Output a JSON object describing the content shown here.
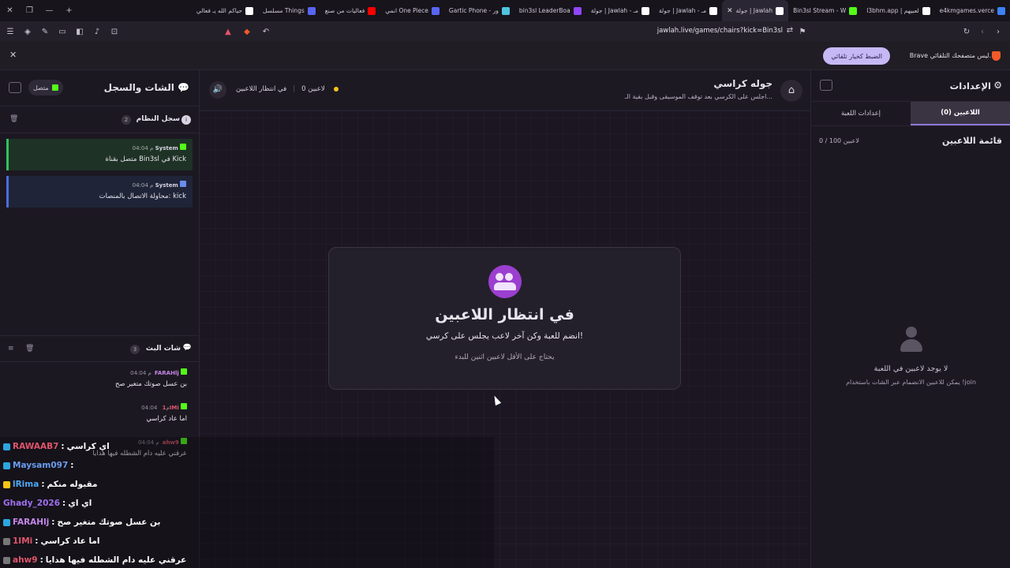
{
  "browser": {
    "tabs": [
      {
        "label": "e4kmgames.verce",
        "color": "#3b82f6"
      },
      {
        "label": "l3bhm.app | لعبيهم",
        "color": "#ffffff"
      },
      {
        "label": "Bin3sl Stream - W",
        "color": "#53fc18"
      },
      {
        "label": "جولة | Jawlah",
        "color": "#ffffff",
        "active": true
      },
      {
        "label": "جولة | Jawlah - مـ",
        "color": "#ffffff"
      },
      {
        "label": "جولة | Jawlah - مـ",
        "color": "#ffffff"
      },
      {
        "label": "bin3sl LeaderBoa",
        "color": "#9146ff"
      },
      {
        "label": "Gartic Phone - ور",
        "color": "#4ec3e0"
      },
      {
        "label": "انمي One Piece",
        "color": "#5865f2"
      },
      {
        "label": "فعاليات من صنع",
        "color": "#ff0000"
      },
      {
        "label": "مسلسل Things",
        "color": "#5865f2"
      },
      {
        "label": "حياكم الله يـ فعالي",
        "color": "#ffffff"
      }
    ],
    "url": "jawlah.live/games/chairs?kick=Bin3sl",
    "brave_message": "Brave ليس متصفحك التلقائي.",
    "brave_button": "الضبط كخيار تلقائي"
  },
  "left_panel": {
    "title": "الشات والسجل",
    "connection": "متصل",
    "system_log": {
      "title": "سجل النظام",
      "count": "2",
      "messages": [
        {
          "user": "System",
          "time": "04:04 م",
          "text": "متصل بقناة Bin3sl في Kick",
          "style": "g"
        },
        {
          "user": "System",
          "time": "04:04 م",
          "text": "محاولة الاتصال بالمنصات: kick",
          "style": "b"
        }
      ]
    },
    "stream_chat": {
      "title": "شات البث",
      "count": "3",
      "messages": [
        {
          "user": "FARAHlj",
          "time": "04:04 م",
          "text": "بن عسل صوتك متغير صح",
          "color": "#c586e8"
        },
        {
          "user": "1IMi",
          "time": "04:04 م",
          "text": "اما عاد كراسي",
          "color": "#e0556b"
        },
        {
          "user": "ahw9",
          "time": "04:04 م",
          "text": "عرقني عليه دام الشطله فيها هدايا",
          "color": "#e0556b"
        }
      ]
    }
  },
  "center": {
    "game_title": "جوله كراسي",
    "game_subtitle": "اجلس على الكرسي بعد توقف الموسيقى وقبل بقية الـ...",
    "players_status": "0 لاعبين",
    "waiting_status": "في انتظار اللاعبين",
    "card": {
      "title": "في انتظار اللاعبين",
      "description": "انضم للعبة وكن آخر لاعب يجلس على كرسي!",
      "note": "يحتاج على الأقل لاعبين اثنين للبدء"
    }
  },
  "right_panel": {
    "title": "الإعدادات",
    "tabs": [
      "اللاعبين (0)",
      "إعدادات اللعبة"
    ],
    "players_list_title": "قائمة اللاعبين",
    "players_count": "0 / 100 لاعبين",
    "empty_title": "لا يوجد لاعبين في اللعبة",
    "empty_hint": "يمكن للاعبين الانضمام عبر الشات باستخدام !join"
  },
  "overlay_chat": [
    {
      "user": "RAWAAB7",
      "msg": "اي كراسي",
      "color": "#e0556b",
      "icon": "#2da6e0"
    },
    {
      "user": "Maysam097",
      "msg": "",
      "color": "#6a9cf0",
      "icon": "#2da6e0"
    },
    {
      "user": "lRima",
      "msg": "مقبوله منكم",
      "color": "#4ea7f0",
      "icon": "#f5c518"
    },
    {
      "user": "Ghady_2026",
      "msg": "اي اي",
      "color": "#a070f0",
      "icon": ""
    },
    {
      "user": "FARAHlj",
      "msg": "بن عسل صوتك متغير صح",
      "color": "#c586e8",
      "icon": "#2da6e0"
    },
    {
      "user": "1IMi",
      "msg": "اما عاد كراسي",
      "color": "#e0556b",
      "icon": "#777777"
    },
    {
      "user": "ahw9",
      "msg": "عرقني عليه دام الشطله فيها هدايا",
      "color": "#e0556b",
      "icon": "#777777"
    }
  ]
}
